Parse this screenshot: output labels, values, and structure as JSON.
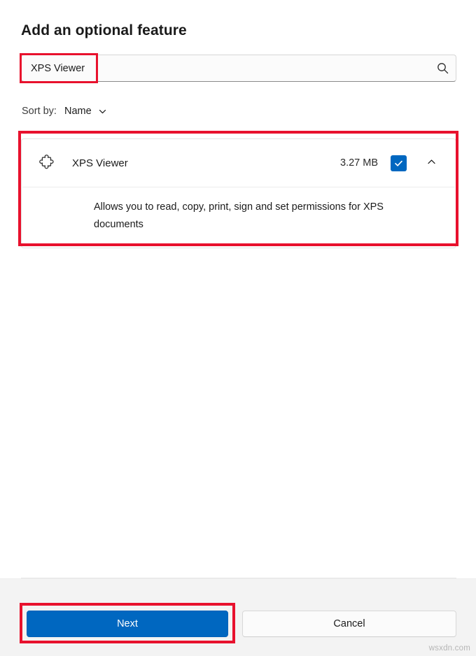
{
  "dialog": {
    "title": "Add an optional feature"
  },
  "search": {
    "value": "XPS Viewer",
    "placeholder": "",
    "icon": "search-icon"
  },
  "sort": {
    "label": "Sort by:",
    "value": "Name",
    "chevron_icon": "chevron-down-icon"
  },
  "feature": {
    "icon": "puzzle-piece-icon",
    "name": "XPS Viewer",
    "size": "3.27 MB",
    "checked": true,
    "check_icon": "checkmark-icon",
    "expander_icon": "chevron-up-icon",
    "expanded": true,
    "description": "Allows you to read, copy, print, sign and set permissions for XPS documents"
  },
  "footer": {
    "next_label": "Next",
    "cancel_label": "Cancel"
  },
  "watermark": "wsxdn.com",
  "colors": {
    "accent": "#0067c0",
    "highlight": "#e8112d",
    "footer_bg": "#f3f3f3",
    "text": "#1b1b1b"
  }
}
